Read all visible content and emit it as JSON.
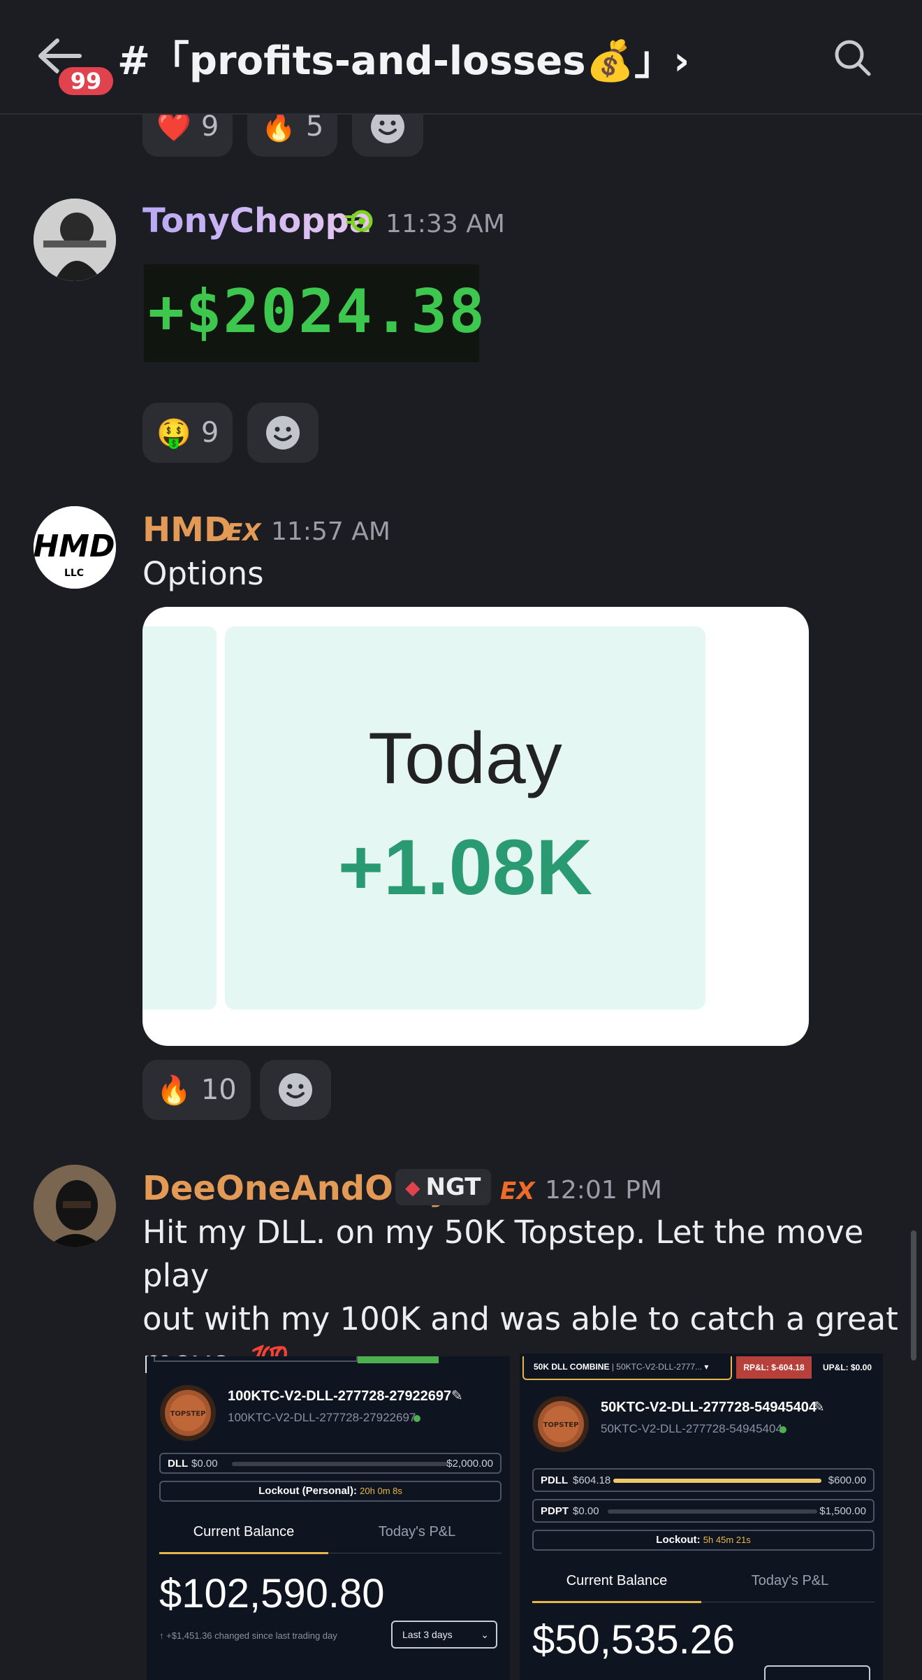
{
  "header": {
    "unread_badge": "99",
    "channel_name": "#「profits-and-losses💰」›"
  },
  "top_reactions": [
    {
      "emoji": "❤️",
      "count": "9"
    },
    {
      "emoji": "🔥",
      "count": "5"
    }
  ],
  "messages": [
    {
      "username": "TonyChoppa",
      "username_color": "#c9b7f0",
      "time": "11:33 AM",
      "big_text": "+$2024.38",
      "reactions": [
        {
          "emoji": "🤑",
          "count": "9"
        }
      ]
    },
    {
      "username": "HMD",
      "username_color": "#e29a56",
      "tag": "EX",
      "time": "11:57 AM",
      "text": "Options",
      "image": {
        "label": "Today",
        "value": "+1.08K"
      },
      "reactions": [
        {
          "emoji": "🔥",
          "count": "10"
        }
      ]
    },
    {
      "username": "DeeOneAndOnly",
      "username_color": "#e29a56",
      "badge": "NGT",
      "tag": "EX",
      "time": "12:01 PM",
      "text_lines": [
        "Hit my DLL. on my 50K Topstep. Let the move play",
        "out with my 100K and was able to catch a great",
        "move. 💯"
      ]
    }
  ],
  "card1": {
    "account": "100KTC-V2-DLL-277728-27922697",
    "account_sub": "100KTC-V2-DLL-277728-27922697",
    "dll_label": "DLL",
    "dll_value": "$0.00",
    "dll_max": "$2,000.00",
    "lockout_label": "Lockout (Personal):",
    "lockout_time": "20h 0m 8s",
    "tab_balance": "Current Balance",
    "tab_pnl": "Today's P&L",
    "balance": "$102,590.80",
    "change": "↑ +$1,451.36 changed since last trading day",
    "range": "Last 3 days"
  },
  "card2": {
    "combine_label": "50K DLL COMBINE",
    "combine_account": "| 50KTC-V2-DLL-2777...",
    "rpl": "RP&L: $-604.18",
    "upl": "UP&L: $0.00",
    "account": "50KTC-V2-DLL-277728-54945404",
    "account_sub": "50KTC-V2-DLL-277728-54945404",
    "pdll_label": "PDLL",
    "pdll_value": "$604.18",
    "pdll_max": "$600.00",
    "pdll_fill": 1.0,
    "pdpt_label": "PDPT",
    "pdpt_value": "$0.00",
    "pdpt_max": "$1,500.00",
    "lockout_label": "Lockout:",
    "lockout_time": "5h 45m 21s",
    "tab_balance": "Current Balance",
    "tab_pnl": "Today's P&L",
    "balance": "$50,535.26"
  }
}
